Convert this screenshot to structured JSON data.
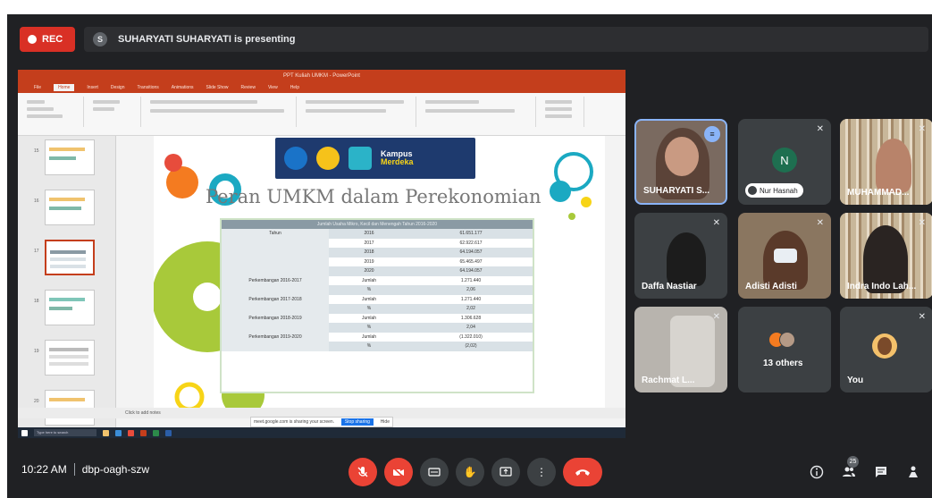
{
  "top_bar": {
    "rec_label": "REC",
    "presenter_initial": "S",
    "presenting_text": "SUHARYATI SUHARYATI is presenting"
  },
  "shared_screen": {
    "window_title": "PPT Kuliah UMKM - PowerPoint",
    "ribbon_tabs": [
      "File",
      "Home",
      "Insert",
      "Design",
      "Transitions",
      "Animations",
      "Slide Show",
      "Review",
      "View",
      "Help"
    ],
    "active_tab": "Home",
    "slide": {
      "logo_text_line1": "Kampus",
      "logo_text_line2": "Merdeka",
      "title": "Peran UMKM dalam Perekonomian",
      "table_header": "Jumlah Usaha Mikro, Kecil dan Menengah Tahun 2016-2020",
      "rows": [
        {
          "label": "Tahun",
          "sub": "2016",
          "value": "61.651.177"
        },
        {
          "label": "",
          "sub": "2017",
          "value": "62.922.617"
        },
        {
          "label": "",
          "sub": "2018",
          "value": "64.194.057"
        },
        {
          "label": "",
          "sub": "2019",
          "value": "65.465.497"
        },
        {
          "label": "",
          "sub": "2020",
          "value": "64.194.057"
        },
        {
          "label": "Perkembangan 2016-2017",
          "sub": "Jumlah",
          "value": "1.271.440"
        },
        {
          "label": "",
          "sub": "%",
          "value": "2,06"
        },
        {
          "label": "Perkembangan 2017-2018",
          "sub": "Jumlah",
          "value": "1.271.440"
        },
        {
          "label": "",
          "sub": "%",
          "value": "2,02"
        },
        {
          "label": "Perkembangan 2018-2019",
          "sub": "Jumlah",
          "value": "1.306.628"
        },
        {
          "label": "",
          "sub": "%",
          "value": "2,04"
        },
        {
          "label": "Perkembangan 2019-2020",
          "sub": "Jumlah",
          "value": "(1.322.010)"
        },
        {
          "label": "",
          "sub": "%",
          "value": "(2,02)"
        }
      ]
    },
    "notes_placeholder": "Click to add notes",
    "share_note": "meet.google.com is sharing your screen.",
    "share_stop": "Stop sharing",
    "share_hide": "Hide",
    "taskbar_search": "Type here to search"
  },
  "participants": [
    {
      "name": "SUHARYATI S...",
      "speaking": true
    },
    {
      "name": "Nur Hasnah",
      "initial": "N"
    },
    {
      "name": "MUHAMMAD..."
    },
    {
      "name": "Daffa Nastiar"
    },
    {
      "name": "Adisti Adisti"
    },
    {
      "name": "Indra Indo Lah..."
    },
    {
      "name": "Rachmat L..."
    },
    {
      "name": "13 others"
    },
    {
      "name": "You"
    }
  ],
  "bottom_bar": {
    "time": "10:22 AM",
    "meeting_code": "dbp-oagh-szw",
    "participant_count": "25"
  },
  "colors": {
    "meet_bg": "#202124",
    "tile_bg": "#3c4043",
    "rec_red": "#d93025",
    "control_red": "#ea4335",
    "ppt_brand": "#c43e1c",
    "table_header": "#8a9aa4"
  }
}
